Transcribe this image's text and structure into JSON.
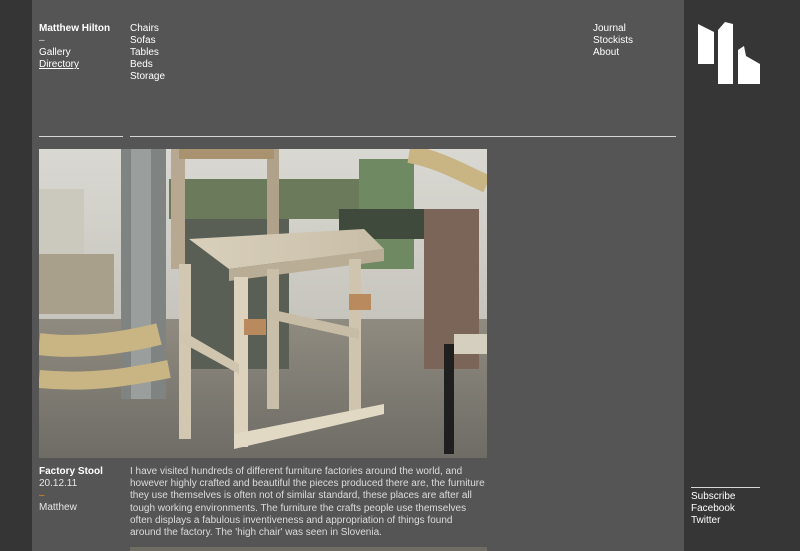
{
  "site": {
    "brand": "Matthew Hilton",
    "dash": "–"
  },
  "nav_primary": [
    {
      "label": "Gallery",
      "current": false
    },
    {
      "label": "Directory",
      "current": true
    }
  ],
  "nav_categories": [
    "Chairs",
    "Sofas",
    "Tables",
    "Beds",
    "Storage"
  ],
  "nav_secondary": [
    "Journal",
    "Stockists",
    "About"
  ],
  "post": {
    "title": "Factory Stool",
    "date": "20.12.11",
    "dash": "–",
    "author": "Matthew",
    "body": "I have visited hundreds of different furniture factories around the world, and however highly crafted and beautiful the pieces produced there are, the furniture they use themselves is often not of similar standard, these places are after all tough working environments. The furniture the crafts people use themselves often displays a fabulous inventiveness and appropriation of things found around the factory. The 'high chair' was seen in Slovenia.",
    "image_alt": "wooden high stool in a furniture factory workshop"
  },
  "social": [
    "Subscribe",
    "Facebook",
    "Twitter"
  ],
  "colors": {
    "background": "#353535",
    "content_panel": "#555555",
    "sidebar": "#363636",
    "text": "#ffffff",
    "accent_dash": "#e08a1e",
    "rule": "#d6d6d6"
  },
  "icons": {
    "logo": "mh-logo-mark"
  }
}
